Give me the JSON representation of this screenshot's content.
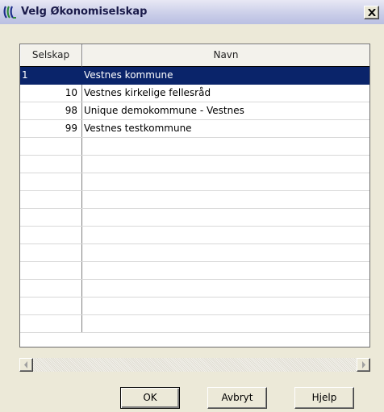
{
  "window": {
    "title": "Velg Økonomiselskap",
    "close_glyph": "✕"
  },
  "table": {
    "columns": [
      "Selskap",
      "Navn"
    ],
    "rows": [
      {
        "selskap": "1",
        "navn": "Vestnes kommune",
        "selected": true
      },
      {
        "selskap": "10",
        "navn": "Vestnes kirkelige fellesråd"
      },
      {
        "selskap": "98",
        "navn": "Unique demokommune - Vestnes"
      },
      {
        "selskap": "99",
        "navn": "Vestnes testkommune"
      },
      {
        "selskap": "",
        "navn": ""
      },
      {
        "selskap": "",
        "navn": ""
      },
      {
        "selskap": "",
        "navn": ""
      },
      {
        "selskap": "",
        "navn": ""
      },
      {
        "selskap": "",
        "navn": ""
      },
      {
        "selskap": "",
        "navn": ""
      },
      {
        "selskap": "",
        "navn": ""
      },
      {
        "selskap": "",
        "navn": ""
      },
      {
        "selskap": "",
        "navn": ""
      },
      {
        "selskap": "",
        "navn": ""
      },
      {
        "selskap": "",
        "navn": ""
      }
    ]
  },
  "buttons": {
    "ok": "OK",
    "cancel": "Avbryt",
    "help": "Hjelp"
  },
  "icons": {
    "app": "app-logo-icon",
    "close": "close-icon",
    "scroll_left": "arrow-left-icon",
    "scroll_right": "arrow-right-icon"
  },
  "colors": {
    "selection": "#0a246a",
    "background": "#ece9d8",
    "title_text": "#1a1a4a"
  }
}
